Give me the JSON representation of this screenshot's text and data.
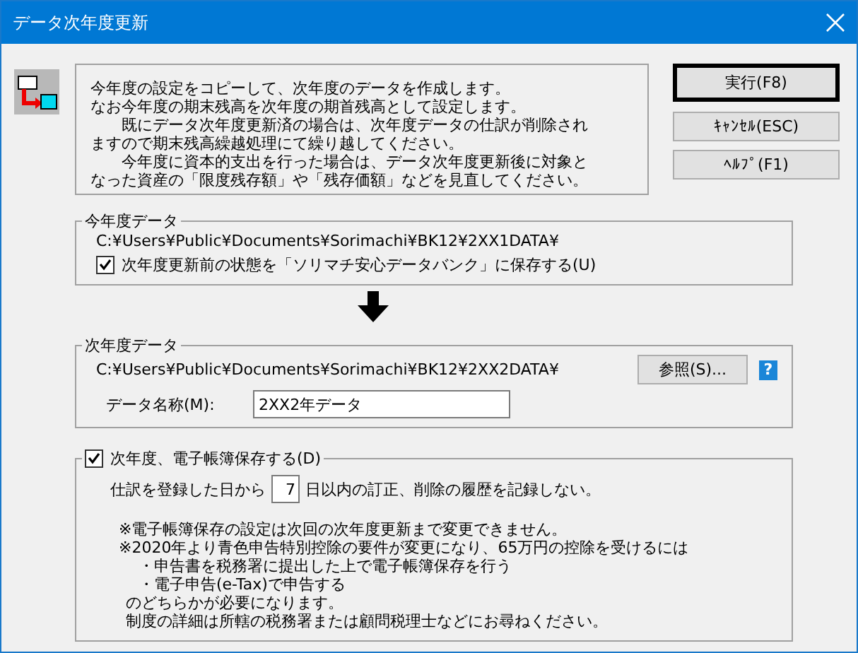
{
  "window": {
    "title": "データ次年度更新"
  },
  "info": {
    "lines": [
      {
        "kind": "line",
        "text": "今年度の設定をコピーして、次年度のデータを作成します。"
      },
      {
        "kind": "line",
        "text": "なお今年度の期末残高を次年度の期首残高として設定します。"
      },
      {
        "kind": "indent",
        "text": "既にデータ次年度更新済の場合は、次年度データの仕訳が削除され"
      },
      {
        "kind": "line",
        "text": "ますので期末残高繰越処理にて繰り越してください。"
      },
      {
        "kind": "indent",
        "text": "今年度に資本的支出を行った場合は、データ次年度更新後に対象と"
      },
      {
        "kind": "line",
        "text": "なった資産の「限度残存額」や「残存価額」などを見直してください。"
      }
    ]
  },
  "buttons": [
    {
      "label": "実行(F8)",
      "default": true
    },
    {
      "label": "ｷｬﾝｾﾙ(ESC)",
      "default": false
    },
    {
      "label": "ﾍﾙﾌﾟ(F1)",
      "default": false
    }
  ],
  "current_data": {
    "title": "今年度データ",
    "path": "C:¥Users¥Public¥Documents¥Sorimachi¥BK12¥2XX1DATA¥",
    "checkbox": {
      "label": "次年度更新前の状態を「ソリマチ安心データバンク」に保存する(U)",
      "checked": true
    }
  },
  "next_data": {
    "title": "次年度データ",
    "path": "C:¥Users¥Public¥Documents¥Sorimachi¥BK12¥2XX2DATA¥",
    "browse_button": "参照(S)...",
    "help_icon": "?",
    "name_label": "データ名称(M):",
    "name_value": "2XX2年データ"
  },
  "ebook": {
    "checkbox": {
      "label": "次年度、電子帳簿保存する(D)",
      "checked": true
    },
    "before": "仕訳を登録した日から",
    "days": "7",
    "after": "日以内の訂正、削除の履歴を記録しない。",
    "notes": [
      {
        "kind": "note",
        "text": "※電子帳簿保存の設定は次回の次年度更新まで変更できません。"
      },
      {
        "kind": "note",
        "text": "※2020年より青色申告特別控除の要件が変更になり、65万円の控除を受けるには"
      },
      {
        "kind": "bullet",
        "text": "・申告書を税務署に提出した上で電子帳簿保存を行う"
      },
      {
        "kind": "bullet",
        "text": "・電子申告(e-Tax)で申告する"
      },
      {
        "kind": "cont",
        "text": "のどちらかが必要になります。"
      },
      {
        "kind": "cont",
        "text": "制度の詳細は所轄の税務署または顧問税理士などにお尋ねください。"
      }
    ]
  }
}
